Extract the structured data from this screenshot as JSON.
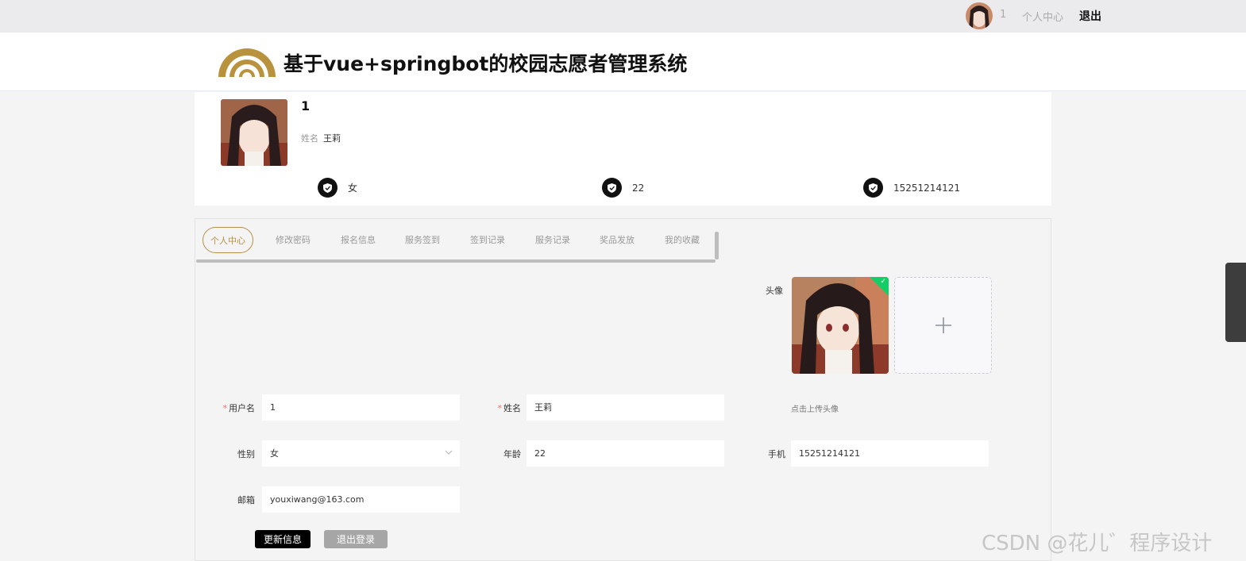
{
  "topbar": {
    "username": "1",
    "user_center": "个人中心",
    "logout": "退出"
  },
  "header": {
    "title": "基于vue+springbot的校园志愿者管理系统",
    "logo_color": "#b8923d"
  },
  "profile": {
    "username": "1",
    "name_label": "姓名",
    "name": "王莉",
    "gender": "女",
    "age": "22",
    "phone": "15251214121"
  },
  "tabs": [
    "个人中心",
    "修改密码",
    "报名信息",
    "服务签到",
    "签到记录",
    "服务记录",
    "奖品发放",
    "我的收藏"
  ],
  "form": {
    "username_label": "用户名",
    "username_value": "1",
    "name_label": "姓名",
    "name_value": "王莉",
    "avatar_label": "头像",
    "upload_hint": "点击上传头像",
    "gender_label": "性别",
    "gender_value": "女",
    "age_label": "年龄",
    "age_value": "22",
    "phone_label": "手机",
    "phone_value": "15251214121",
    "email_label": "邮箱",
    "email_value": "youxiwang@163.com",
    "update_button": "更新信息",
    "logout_button": "退出登录"
  },
  "watermark": "CSDN @花儿゛程序设计",
  "colors": {
    "accent": "#b98f44",
    "required": "#f56c6c",
    "success": "#13ce66"
  },
  "icons": [
    "shield-icon",
    "plus-icon",
    "chevron-down-icon",
    "check-icon",
    "logo-icon"
  ]
}
